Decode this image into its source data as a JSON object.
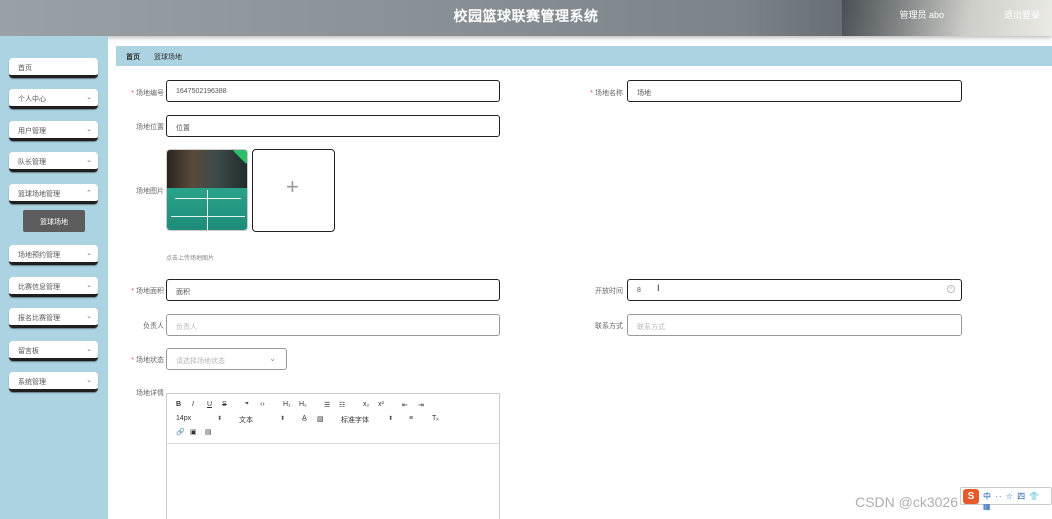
{
  "header": {
    "title": "校园篮球联赛管理系统",
    "user": "管理员 abo",
    "logout": "退出登录"
  },
  "sidebar": {
    "items": [
      {
        "label": "首页",
        "has_chevron": false
      },
      {
        "label": "个人中心",
        "has_chevron": true
      },
      {
        "label": "用户管理",
        "has_chevron": true
      },
      {
        "label": "队长管理",
        "has_chevron": true
      },
      {
        "label": "篮球场地管理",
        "has_chevron": true
      },
      {
        "label": "场地预约管理",
        "has_chevron": true
      },
      {
        "label": "比赛信息管理",
        "has_chevron": true
      },
      {
        "label": "报名比赛管理",
        "has_chevron": true
      },
      {
        "label": "留言板",
        "has_chevron": true
      },
      {
        "label": "系统管理",
        "has_chevron": true
      }
    ],
    "submenu": {
      "label": "篮球场地"
    },
    "chevron_glyph": "⌄"
  },
  "breadcrumb": {
    "home": "首页",
    "current": "篮球场地"
  },
  "form": {
    "code": {
      "label": "场地编号",
      "value": "1647502196388",
      "required": true
    },
    "name": {
      "label": "场地名称",
      "value": "场地",
      "required": true
    },
    "location": {
      "label": "场地位置",
      "value": "位置"
    },
    "image": {
      "label": "场地图片",
      "hint": "点击上传场地图片",
      "add_glyph": "+",
      "uploaded_badge": "✓"
    },
    "area": {
      "label": "场地面积",
      "value": "面积",
      "required": true
    },
    "open_time": {
      "label": "开放时间",
      "value": "8",
      "cursor_glyph": "I",
      "clear_glyph": "×"
    },
    "manager": {
      "label": "负责人",
      "placeholder": "负责人"
    },
    "contact": {
      "label": "联系方式",
      "placeholder": "联系方式"
    },
    "status": {
      "label": "场地状态",
      "placeholder": "请选择场地状态",
      "required": true,
      "caret": "⌄"
    },
    "detail": {
      "label": "场地详情"
    },
    "required_mark": "*"
  },
  "editor": {
    "row1": [
      "B",
      "I",
      "U",
      "S",
      "❞",
      "‹›",
      "H₁",
      "H₂",
      "☰",
      "☷",
      "x₂",
      "x²",
      "⇤",
      "⇥"
    ],
    "font_size": "14px",
    "text_type": "文本",
    "font_family": "标准字体",
    "select_arrow": "⬍",
    "row2_icons": [
      "A̲",
      "▨",
      "≡",
      "Tₓ"
    ],
    "row3": [
      "🔗",
      "▣",
      "▤"
    ]
  },
  "watermark": "CSDN @ck3026",
  "ime": {
    "logo": "S",
    "text": "中 ·· ☆ 四 👕 ▦"
  }
}
